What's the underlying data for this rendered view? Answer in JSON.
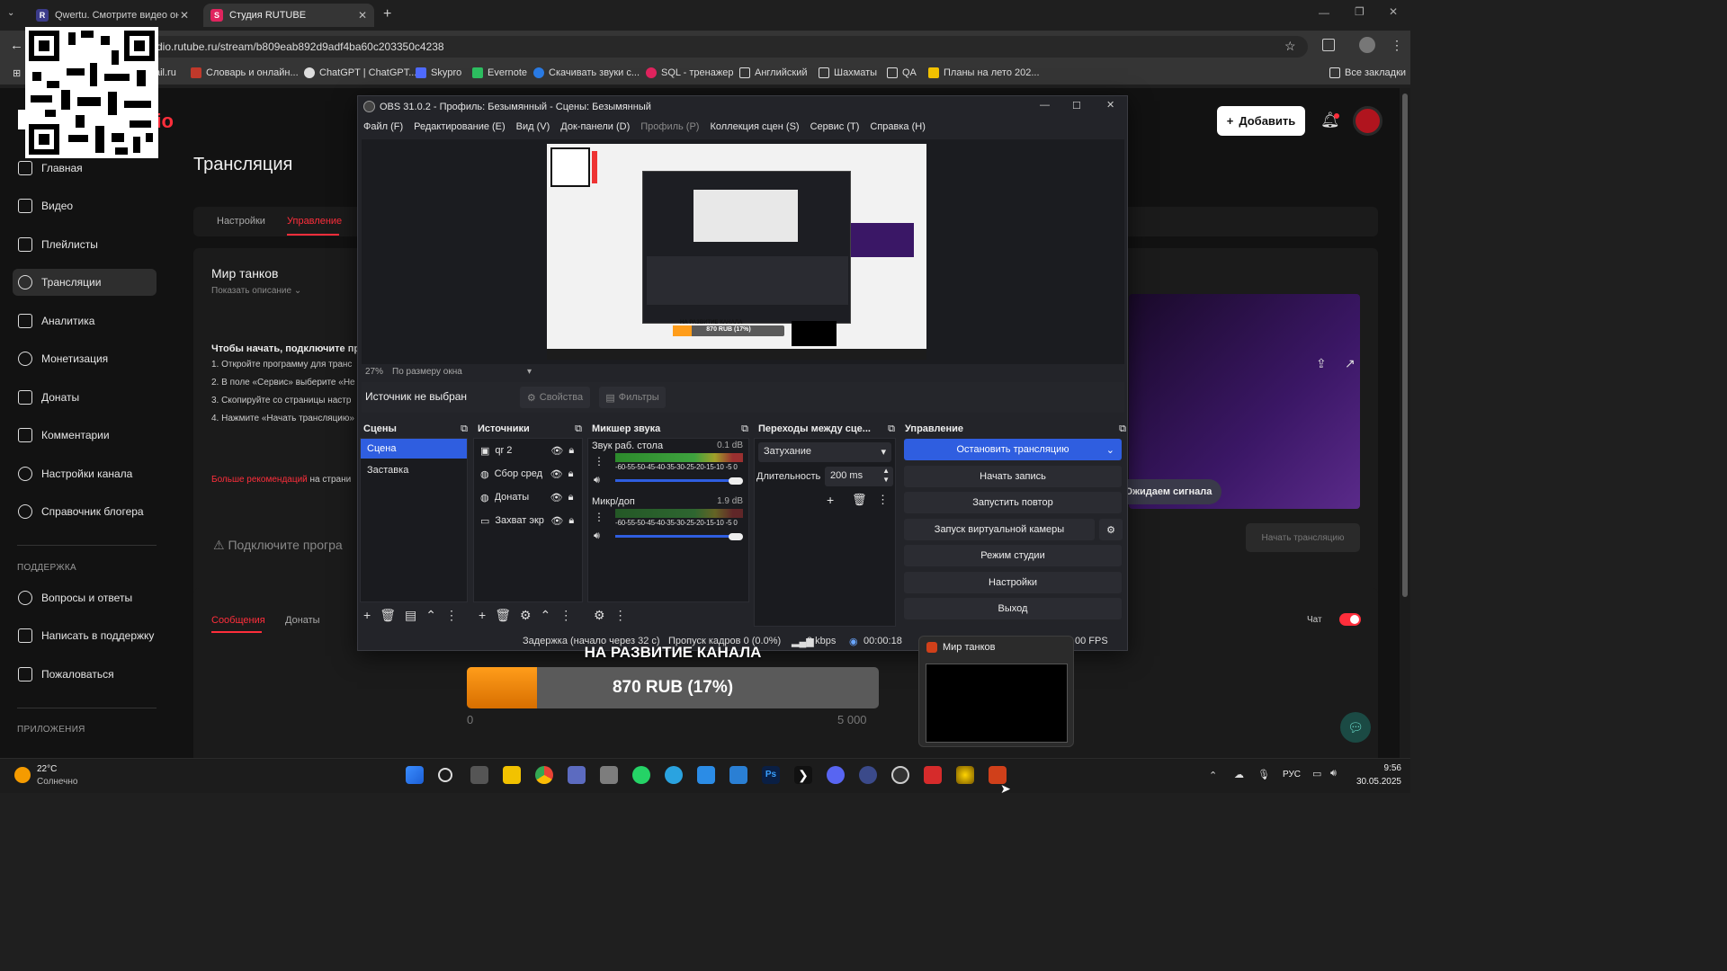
{
  "browser": {
    "tabs": [
      {
        "title": "Qwertu. Смотрите видео онла"
      },
      {
        "title": "Студия RUTUBE"
      }
    ],
    "url": "dio.rutube.ru/stream/b809eab892d9adf4ba60c203350c4238",
    "bookmarks": [
      "ail.ru",
      "Словарь и онлайн...",
      "ChatGPT | ChatGPT...",
      "Skypro",
      "Evernote",
      "Скачивать звуки с...",
      "SQL - тренажер",
      "Английский",
      "Шахматы",
      "QA",
      "Планы на лето 202...",
      "Все закладки"
    ]
  },
  "studio": {
    "logo": "dio",
    "add_button": "Добавить",
    "nav": [
      "Главная",
      "Видео",
      "Плейлисты",
      "Трансляции",
      "Аналитика",
      "Монетизация",
      "Донаты",
      "Комментарии",
      "Настройки канала",
      "Справочник блогера"
    ],
    "support_label": "ПОДДЕРЖКА",
    "support": [
      "Вопросы и ответы",
      "Написать в поддержку",
      "Пожаловаться"
    ],
    "apps_label": "ПРИЛОЖЕНИЯ",
    "page_title": "Трансляция",
    "tabs": [
      "Настройки",
      "Управление"
    ],
    "stream_name": "Мир танков",
    "show_desc": "Показать описание",
    "instructions_title": "Чтобы начать, подключите прог",
    "steps": [
      "1. Откройте программу для транс",
      "2. В поле «Сервис» выберите «Не",
      "3. Скопируйте со страницы настр",
      "4. Нажмите «Начать трансляцию»"
    ],
    "more_link": "Больше рекомендаций",
    "more_rest": " на страни",
    "connect_warning": "Подключите програ",
    "waiting_signal": "Ожидаем сигнала",
    "start_stream": "Начать трансляцию",
    "chat_tabs": [
      "Сообщения",
      "Донаты"
    ],
    "chat_label": "Чат"
  },
  "obs": {
    "title": "OBS 31.0.2 - Профиль: Безымянный - Сцены: Безымянный",
    "menu": [
      "Файл (F)",
      "Редактирование (E)",
      "Вид (V)",
      "Док-панели (D)",
      "Профиль (P)",
      "Коллекция сцен (S)",
      "Сервис (T)",
      "Справка (H)"
    ],
    "zoom": "27%",
    "zoom_mode": "По размеру окна",
    "no_source": "Источник не выбран",
    "properties": "Свойства",
    "filters": "Фильтры",
    "docks": {
      "scenes": "Сцены",
      "sources": "Источники",
      "mixer": "Микшер звука",
      "transitions": "Переходы между сце...",
      "controls": "Управление"
    },
    "scenes": [
      "Сцена",
      "Заставка"
    ],
    "sources": [
      "qr 2",
      "Сбор сред",
      "Донаты",
      "Захват экр"
    ],
    "mixer": [
      {
        "name": "Звук раб. стола",
        "db": "0.1 dB"
      },
      {
        "name": "Микр/доп",
        "db": "1.9 dB"
      }
    ],
    "meter_ticks": "-60-55-50-45-40-35-30-25-20-15-10 -5 0",
    "transition": "Затухание",
    "duration_label": "Длительность",
    "duration": "200 ms",
    "controls": [
      "Остановить трансляцию",
      "Начать запись",
      "Запустить повтор",
      "Запуск виртуальной камеры",
      "Режим студии",
      "Настройки",
      "Выход"
    ],
    "status": {
      "delay": "Задержка (начало через 32 с)",
      "dropped": "Пропуск кадров 0 (0.0%)",
      "kbps": "0 kbps",
      "time": "00:00:18",
      "fps": "00 FPS"
    }
  },
  "overlay": {
    "title": "НА РАЗВИТИЕ КАНАЛА",
    "amount": "870 RUB (17%)",
    "min": "0",
    "max": "5 000",
    "progress": 0.17
  },
  "preview_overlay": {
    "title": "НА РАЗВИТИЕ КАНАЛА",
    "amount": "870 RUB (17%)"
  },
  "taskbar": {
    "weather_temp": "22°C",
    "weather_desc": "Солнечно",
    "lang": "РУС",
    "time": "9:56",
    "date": "30.05.2025",
    "popup_title": "Мир танков"
  },
  "colors": {
    "accent": "#2f5ee0",
    "rutube_red": "#ff2e3b",
    "orange": "#ff8c00"
  }
}
